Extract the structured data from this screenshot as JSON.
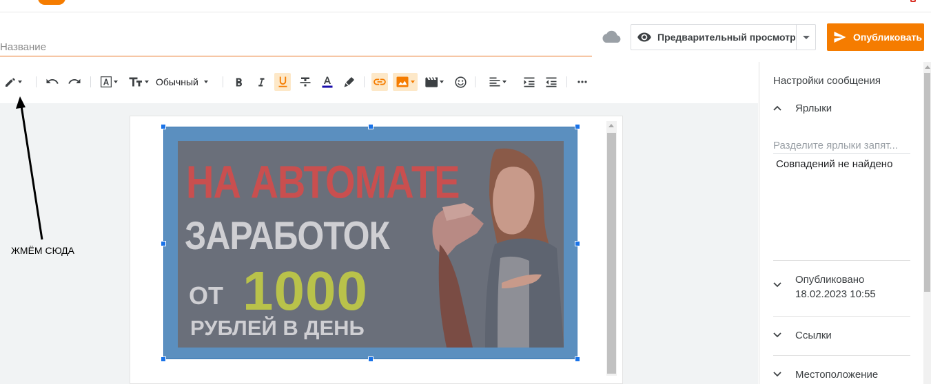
{
  "header": {
    "title_placeholder": "Название",
    "title_value": "",
    "preview_label": "Предварительный просмотр",
    "publish_label": "Опубликовать"
  },
  "toolbar": {
    "paragraph_style": "Обычный"
  },
  "editor": {
    "image": {
      "line1": "НА АВТОМАТЕ",
      "line2": "ЗАРАБОТОК",
      "from": "ОТ",
      "amount": "1000",
      "line4": "РУБЛЕЙ В ДЕНЬ"
    }
  },
  "annotation": {
    "text": "ЖМЁМ СЮДА"
  },
  "sidebar": {
    "title": "Настройки сообщения",
    "labels": {
      "heading": "Ярлыки",
      "input_placeholder": "Разделите ярлыки запят...",
      "no_matches": "Совпадений не найдено"
    },
    "published": {
      "heading": "Опубликовано",
      "date": "18.02.2023 10:55"
    },
    "links": {
      "heading": "Ссылки"
    },
    "location": {
      "heading": "Местоположение"
    }
  },
  "colors": {
    "accent": "#f57c00",
    "selection": "#1a73e8",
    "image_overlay": "#5b8fbf",
    "text_red": "#c94f4f",
    "text_yellow": "#b9c24a"
  },
  "icons": {
    "compose_mode": "pencil-icon",
    "cloud": "cloud-icon",
    "preview": "eye-icon",
    "publish": "send-icon"
  }
}
